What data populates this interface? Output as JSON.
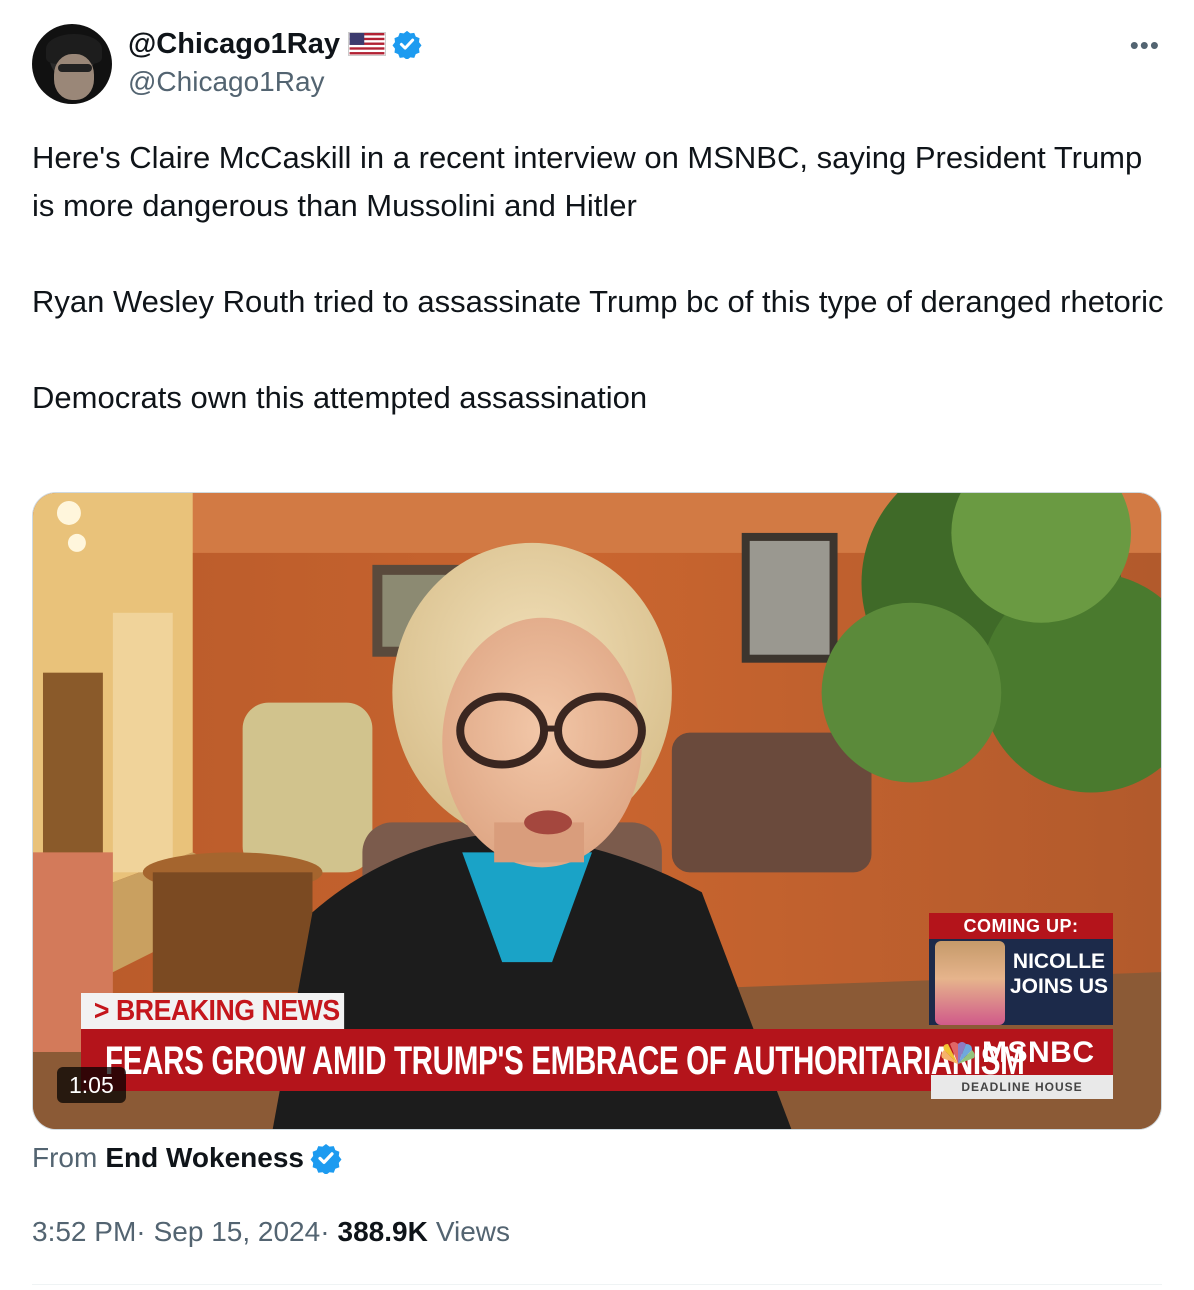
{
  "author": {
    "display_name": "@Chicago1Ray",
    "handle": "@Chicago1Ray",
    "flag_icon": "us-flag-icon",
    "verified_color": "#1d9bf0"
  },
  "menu": {
    "more_label": "•••"
  },
  "tweet": {
    "paragraphs": [
      "Here's Claire McCaskill in a recent interview on MSNBC, saying President Trump is more dangerous than Mussolini and Hitler",
      "Ryan Wesley Routh tried to assassinate Trump bc of this type of deranged rhetoric",
      "Democrats own this attempted assassination"
    ]
  },
  "video": {
    "duration": "1:05",
    "breaking_label": "> BREAKING NEWS",
    "headline": "FEARS GROW AMID TRUMP'S EMBRACE OF AUTHORITARIANISM",
    "network": "MSNBC",
    "show_bar": "DEADLINE HOUSE",
    "coming_up": {
      "label": "COMING UP:",
      "line1": "NICOLLE",
      "line2": "JOINS US"
    },
    "colors": {
      "red": "#b4141b",
      "wall": "#c2582c"
    }
  },
  "source": {
    "prefix": "From",
    "name": "End Wokeness"
  },
  "meta": {
    "time": "3:52 PM",
    "date": "Sep 15, 2024",
    "separator": "·",
    "views_count": "388.9K",
    "views_label": "Views"
  }
}
